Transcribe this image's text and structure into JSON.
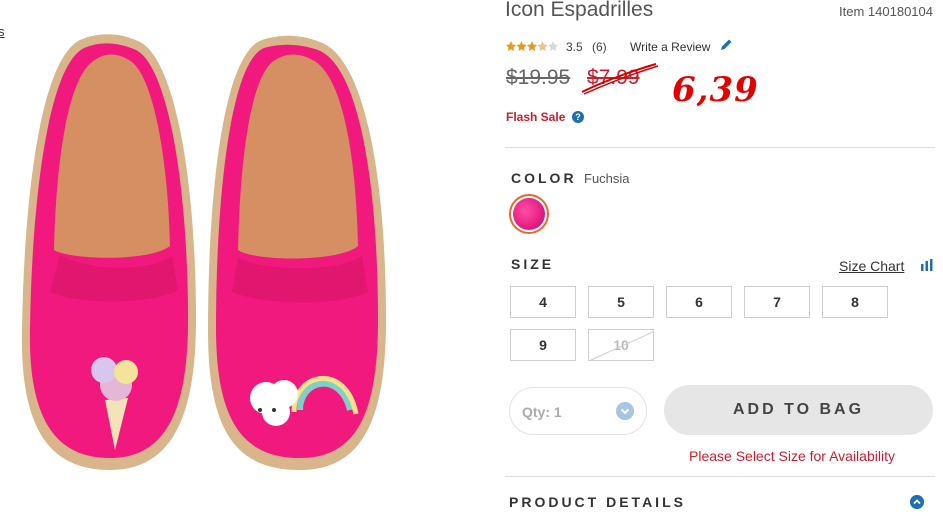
{
  "edge_link": "s",
  "product": {
    "title": "Icon Espadrilles",
    "item_number": "Item 140180104",
    "rating": "3.5",
    "review_count": "(6)",
    "write_review": "Write a Review",
    "price_original": "$19.95",
    "price_sale": "$7.99",
    "handwritten_note": "6,39",
    "flash_sale": "Flash Sale",
    "help_glyph": "?"
  },
  "color": {
    "label": "COLOR",
    "value": "Fuchsia",
    "swatch_color": "#e0157d"
  },
  "size": {
    "label": "SIZE",
    "chart_link": "Size Chart",
    "options": [
      "4",
      "5",
      "6",
      "7",
      "8",
      "9",
      "10"
    ],
    "unavailable": [
      "10"
    ]
  },
  "quantity": {
    "label": "Qty: 1"
  },
  "add_to_bag": "ADD TO BAG",
  "availability_message": "Please Select Size for Availability",
  "details": {
    "label": "PRODUCT DETAILS"
  },
  "colors": {
    "accent_red": "#c8202f",
    "link_blue": "#1f6fb2",
    "selected_orange": "#e46a2c"
  },
  "icons": [
    "star-rating-icon",
    "pencil-icon",
    "help-icon",
    "bar-chart-icon",
    "chevron-down-icon"
  ]
}
